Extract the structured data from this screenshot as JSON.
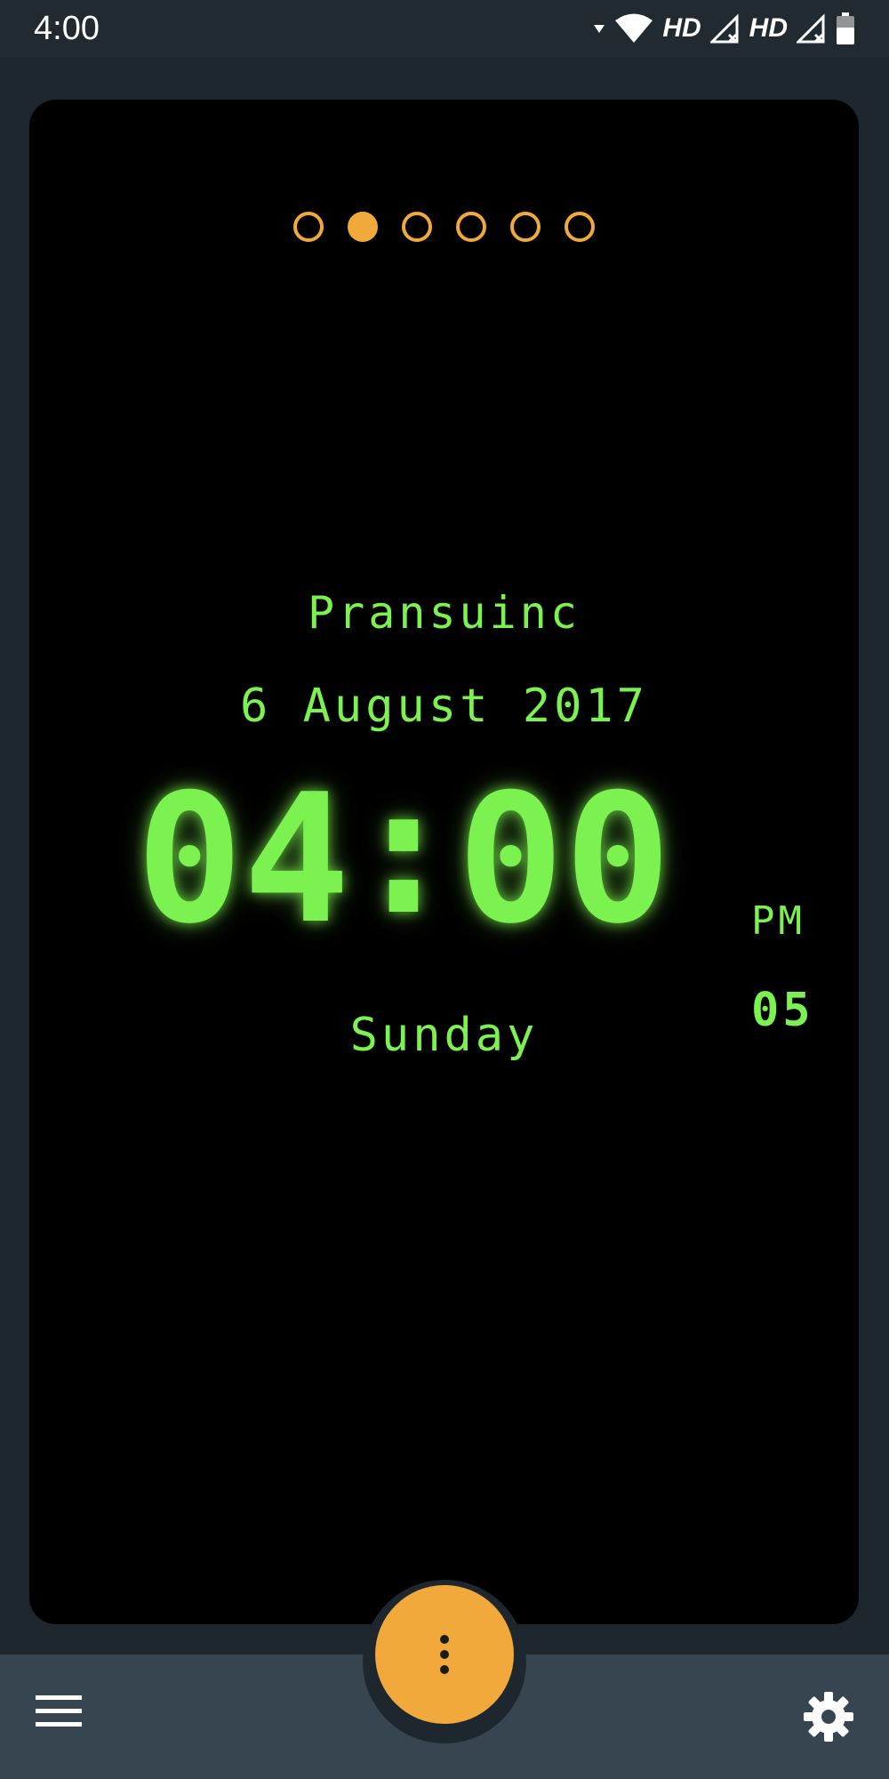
{
  "status_bar": {
    "time": "4:00",
    "network_label_1": "HD",
    "network_label_2": "HD",
    "icons": [
      "wifi-icon",
      "signal-icon",
      "signal-icon",
      "battery-icon"
    ]
  },
  "pager": {
    "page_count": 6,
    "active_index": 1,
    "color": "#f2a93b"
  },
  "clock": {
    "owner": "Pransuinc",
    "date": "6 August 2017",
    "hours": "04",
    "separator": ":",
    "minutes": "00",
    "ampm": "PM",
    "seconds": "05",
    "day": "Sunday",
    "color": "#7cf250"
  },
  "bottom_bar": {
    "left_icon": "hamburger-menu-icon",
    "fab_icon": "vertical-dots-icon",
    "right_icon": "gear-icon",
    "fab_color": "#f2a93b"
  }
}
